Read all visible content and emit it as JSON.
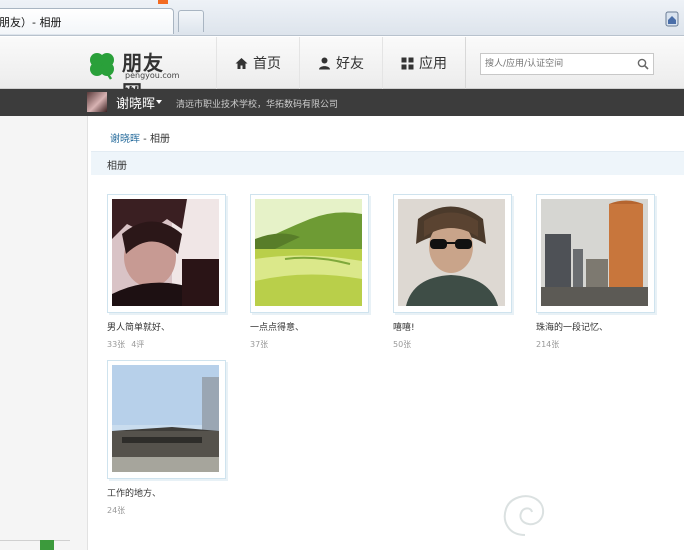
{
  "browser": {
    "tab_title": "朋友）- 相册"
  },
  "header": {
    "logo_text": "朋友网",
    "logo_sub": "pengyou.com",
    "nav": [
      {
        "label": "首页",
        "icon": "home-icon"
      },
      {
        "label": "好友",
        "icon": "user-icon"
      },
      {
        "label": "应用",
        "icon": "apps-icon"
      }
    ],
    "search_placeholder": "搜人/应用/认证空间"
  },
  "userbar": {
    "username": "谢晓晖",
    "info": "清远市职业技术学校，华拓数码有限公司"
  },
  "breadcrumb": {
    "user": "谢晓晖",
    "separator": " - ",
    "current": "相册"
  },
  "section": {
    "title": "相册"
  },
  "albums": [
    {
      "name": "男人简单就好、",
      "photos": "33张",
      "comments": "4评"
    },
    {
      "name": "一点点得意、",
      "photos": "37张",
      "comments": ""
    },
    {
      "name": "嘻嘻!",
      "photos": "50张",
      "comments": ""
    },
    {
      "name": "珠海的一段记忆、",
      "photos": "214张",
      "comments": ""
    },
    {
      "name": "工作的地方、",
      "photos": "24张",
      "comments": ""
    }
  ],
  "colors": {
    "accent_link": "#2a6e9e",
    "userbar_bg": "#3c3c3c",
    "logo_green": "#2aa03a"
  }
}
